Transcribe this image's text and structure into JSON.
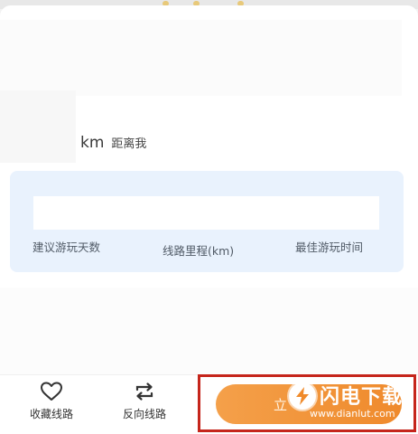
{
  "distance": {
    "unit": "km",
    "label": "距离我"
  },
  "stats": {
    "days_label": "建议游玩天数",
    "mileage_label": "线路里程(km)",
    "best_time_label": "最佳游玩时间"
  },
  "actions": {
    "favorite_label": "收藏线路",
    "reverse_label": "反向线路",
    "go_button_text": "立"
  },
  "watermark": {
    "title": "闪电下载",
    "url": "www.dianlut.com"
  },
  "colors": {
    "button_orange": "#ef8a2c",
    "highlight_red": "#c5251b",
    "stats_bg": "#e9f2fd"
  },
  "icons": {
    "favorite": "heart-icon",
    "reverse": "swap-arrows-icon",
    "watermark": "lightning-icon"
  }
}
